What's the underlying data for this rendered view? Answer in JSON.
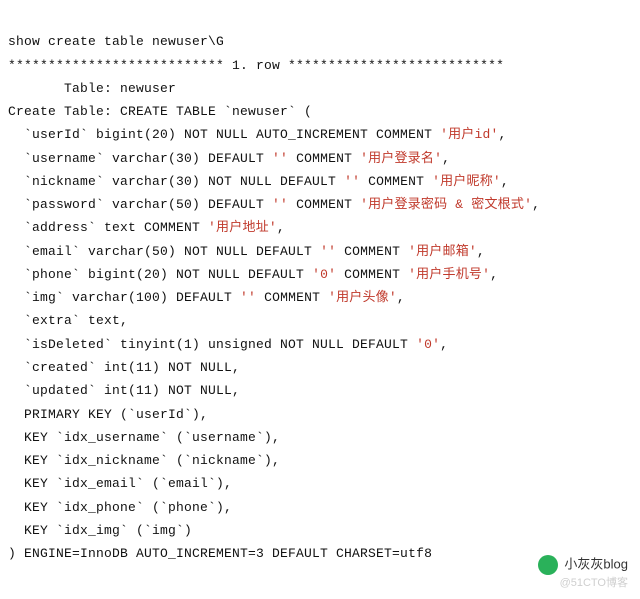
{
  "lines": {
    "l01": "show create table newuser\\G",
    "l02_a": "*************************** 1. row ***************************",
    "l03": "       Table: newuser",
    "l04": "Create Table: CREATE TABLE `newuser` (",
    "l05_a": "  `userId` bigint(20) NOT NULL AUTO_INCREMENT COMMENT ",
    "l05_b": "'用户id'",
    "l05_c": ",",
    "l06_a": "  `username` varchar(30) DEFAULT ",
    "l06_b": "''",
    "l06_c": " COMMENT ",
    "l06_d": "'用户登录名'",
    "l06_e": ",",
    "l07_a": "  `nickname` varchar(30) NOT NULL DEFAULT ",
    "l07_b": "''",
    "l07_c": " COMMENT ",
    "l07_d": "'用户昵称'",
    "l07_e": ",",
    "l08_a": "  `password` varchar(50) DEFAULT ",
    "l08_b": "''",
    "l08_c": " COMMENT ",
    "l08_d": "'用户登录密码 & 密文根式'",
    "l08_e": ",",
    "l09_a": "  `address` text COMMENT ",
    "l09_b": "'用户地址'",
    "l09_c": ",",
    "l10_a": "  `email` varchar(50) NOT NULL DEFAULT ",
    "l10_b": "''",
    "l10_c": " COMMENT ",
    "l10_d": "'用户邮箱'",
    "l10_e": ",",
    "l11_a": "  `phone` bigint(20) NOT NULL DEFAULT ",
    "l11_b": "'0'",
    "l11_c": " COMMENT ",
    "l11_d": "'用户手机号'",
    "l11_e": ",",
    "l12_a": "  `img` varchar(100) DEFAULT ",
    "l12_b": "''",
    "l12_c": " COMMENT ",
    "l12_d": "'用户头像'",
    "l12_e": ",",
    "l13": "  `extra` text,",
    "l14_a": "  `isDeleted` tinyint(1) unsigned NOT NULL DEFAULT ",
    "l14_b": "'0'",
    "l14_c": ",",
    "l15": "  `created` int(11) NOT NULL,",
    "l16": "  `updated` int(11) NOT NULL,",
    "l17": "  PRIMARY KEY (`userId`),",
    "l18": "  KEY `idx_username` (`username`),",
    "l19": "  KEY `idx_nickname` (`nickname`),",
    "l20": "  KEY `idx_email` (`email`),",
    "l21": "  KEY `idx_phone` (`phone`),",
    "l22": "  KEY `idx_img` (`img`)",
    "l23": ") ENGINE=InnoDB AUTO_INCREMENT=3 DEFAULT CHARSET=utf8"
  },
  "watermark": {
    "line1": "小灰灰blog",
    "line2": "@51CTO博客"
  }
}
